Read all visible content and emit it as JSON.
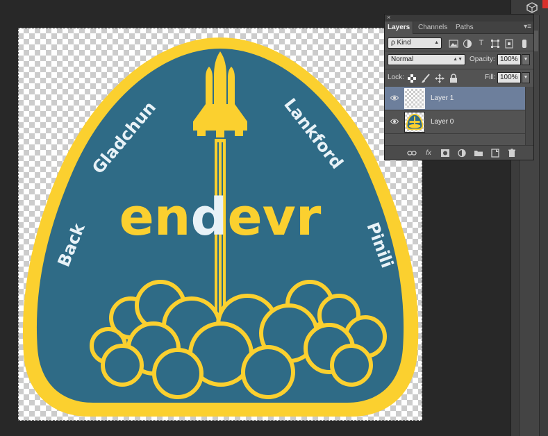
{
  "canvas": {
    "patch": {
      "brand_part1": "en",
      "brand_part2": "d",
      "brand_part3": "evr",
      "names": [
        "Back",
        "Gladchun",
        "Lankford",
        "Pinili"
      ]
    }
  },
  "layers_panel": {
    "close_glyph": "×",
    "menu_glyph": "▾≡",
    "tabs": [
      {
        "label": "Layers",
        "active": true
      },
      {
        "label": "Channels",
        "active": false
      },
      {
        "label": "Paths",
        "active": false
      }
    ],
    "filter": {
      "search_glyph": "ρ",
      "kind_label": "Kind"
    },
    "blend_mode": "Normal",
    "opacity_label": "Opacity:",
    "opacity_value": "100%",
    "lock_label": "Lock:",
    "fill_label": "Fill:",
    "fill_value": "100%",
    "layers": [
      {
        "name": "Layer 1",
        "selected": true
      },
      {
        "name": "Layer 0",
        "selected": false
      }
    ],
    "footer_icons": [
      "link-icon",
      "fx-icon",
      "mask-icon",
      "adjustment-icon",
      "group-folder-icon",
      "new-layer-icon",
      "trash-icon"
    ]
  },
  "colors": {
    "patch_blue": "#2f6b86",
    "patch_yellow": "#fbd02f",
    "patch_white": "#e8f2f7",
    "selection_highlight": "#6d7f9c"
  }
}
